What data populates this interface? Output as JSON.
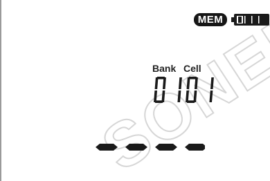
{
  "display": {
    "mem_badge": "MEM",
    "battery_level": 1.0,
    "bank_label": "Bank",
    "cell_label": "Cell",
    "bank_cell_value": "0101",
    "measurement_value": "----",
    "watermark": "SONEL"
  },
  "icons": {
    "battery": "battery-full-icon"
  },
  "colors": {
    "segment": "#1a1a1a",
    "background": "#ffffff",
    "watermark": "#e9e9e9"
  }
}
